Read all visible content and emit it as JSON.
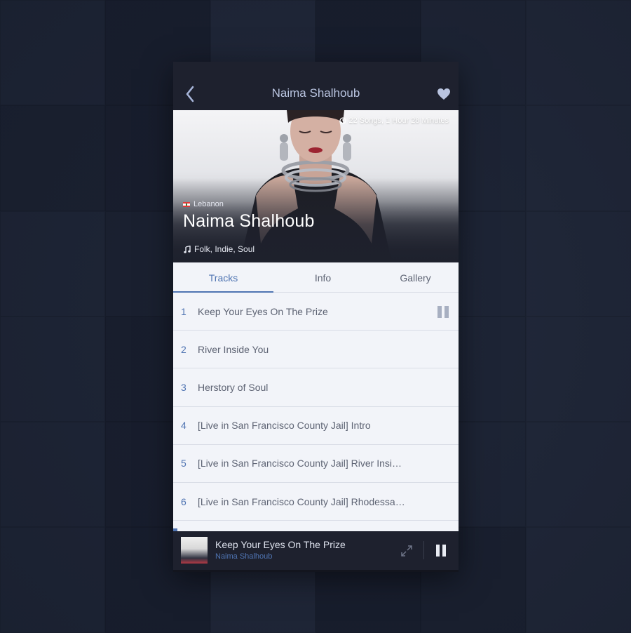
{
  "header": {
    "title": "Naima Shalhoub"
  },
  "hero": {
    "duration": "22 Songs, 1 Hour 28 Minutes",
    "country": "Lebanon",
    "artist_name": "Naima Shalhoub",
    "genres": "Folk, Indie, Soul"
  },
  "tabs": [
    {
      "label": "Tracks",
      "active": true
    },
    {
      "label": "Info",
      "active": false
    },
    {
      "label": "Gallery",
      "active": false
    }
  ],
  "tracks": [
    {
      "number": "1",
      "title": "Keep Your Eyes On The Prize",
      "playing": true
    },
    {
      "number": "2",
      "title": "River Inside You"
    },
    {
      "number": "3",
      "title": "Herstory of Soul"
    },
    {
      "number": "4",
      "title": "[Live in San Francisco County Jail] Intro"
    },
    {
      "number": "5",
      "title": "[Live in San Francisco County Jail] River Insi…"
    },
    {
      "number": "6",
      "title": "[Live in San Francisco County Jail] Rhodessa…"
    }
  ],
  "now_playing": {
    "title": "Keep Your Eyes On The Prize",
    "artist": "Naima Shalhoub"
  },
  "colors": {
    "accent": "#4f74b2",
    "nav_bg": "#1e212e",
    "list_bg": "#f2f4f9",
    "text_muted": "#5d6373",
    "background": "#1c2233"
  },
  "icons": {
    "back": "chevron-left-icon",
    "favorite": "heart-icon",
    "duration": "clock-icon",
    "genre": "music-note-icon",
    "pause": "pause-icon",
    "expand": "expand-icon"
  }
}
